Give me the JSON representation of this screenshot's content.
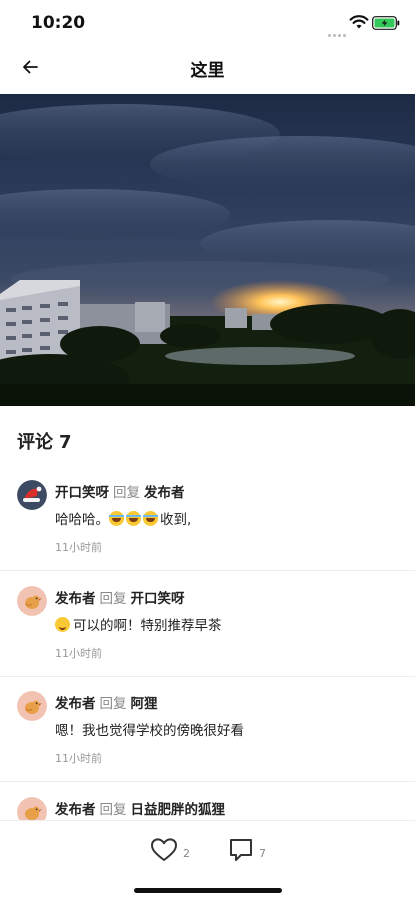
{
  "status_bar": {
    "time": "10:20"
  },
  "nav": {
    "title": "这里"
  },
  "comments_header": {
    "label": "评论",
    "count": "7"
  },
  "comments": [
    {
      "author": "开口笑呀",
      "reply_word": "回复",
      "target": "发布者",
      "text_before": "哈哈哈。",
      "text_after": "收到,",
      "time": "11小时前",
      "avatar": "santa-hat-avatar"
    },
    {
      "author": "发布者",
      "reply_word": "回复",
      "target": "开口笑呀",
      "text": "可以的啊！特别推荐早茶",
      "time": "11小时前",
      "avatar": "bird-avatar"
    },
    {
      "author": "发布者",
      "reply_word": "回复",
      "target": "阿狸",
      "text": "嗯！我也觉得学校的傍晚很好看",
      "time": "11小时前",
      "avatar": "bird-avatar"
    },
    {
      "author": "发布者",
      "reply_word": "回复",
      "target": "日益肥胖的狐狸",
      "avatar": "bird-avatar"
    }
  ],
  "bottom_bar": {
    "like_count": "2",
    "comment_count": "7"
  },
  "colors": {
    "battery": "#34c759",
    "avatar_bg": "#f2c2b3"
  }
}
